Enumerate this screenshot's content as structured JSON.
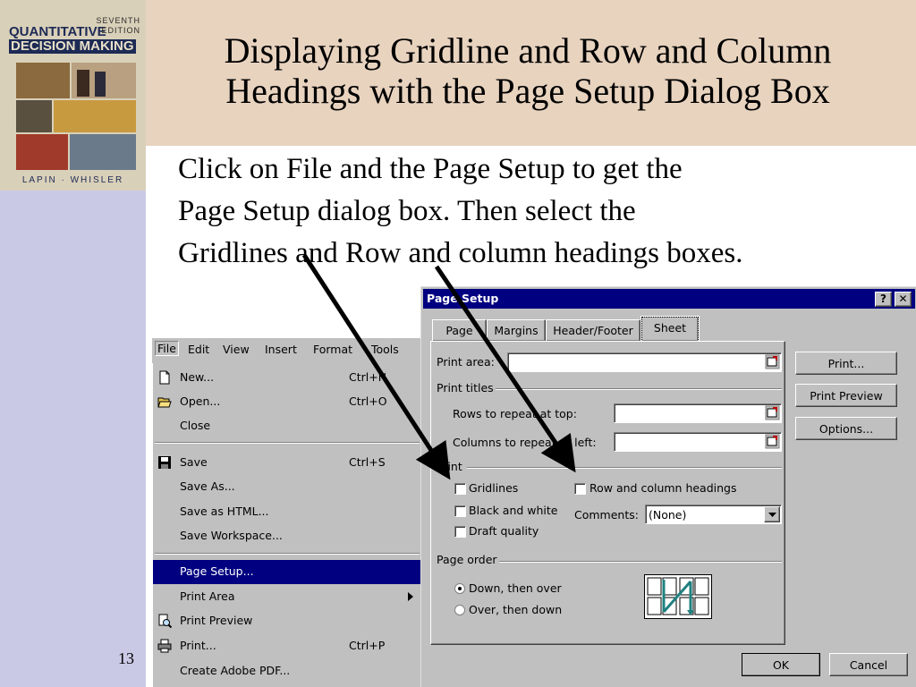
{
  "slide": {
    "title_line1": "Displaying Gridline and Row and Column",
    "title_line2": "Headings with the Page Setup Dialog Box",
    "body_line1": "Click on File and the Page Setup to get the",
    "body_line2": "Page Setup dialog box.  Then select the",
    "body_line3": "Gridlines and Row and column headings boxes.",
    "slide_number": "13"
  },
  "book": {
    "title_line1": "QUANTITATIVE",
    "title_line2": "DECISION MAKING",
    "edition_line1": "SEVENTH",
    "edition_line2": "EDITION",
    "authors": "LAPIN · WHISLER"
  },
  "menubar": {
    "file": "File",
    "edit": "Edit",
    "view": "View",
    "insert": "Insert",
    "format": "Format",
    "tools": "Tools"
  },
  "file_menu": {
    "new": {
      "label": "New...",
      "shortcut": "Ctrl+N"
    },
    "open": {
      "label": "Open...",
      "shortcut": "Ctrl+O"
    },
    "close": {
      "label": "Close"
    },
    "save": {
      "label": "Save",
      "shortcut": "Ctrl+S"
    },
    "save_as": {
      "label": "Save As..."
    },
    "save_html": {
      "label": "Save as HTML..."
    },
    "save_workspace": {
      "label": "Save Workspace..."
    },
    "page_setup": {
      "label": "Page Setup..."
    },
    "print_area": {
      "label": "Print Area"
    },
    "print_preview": {
      "label": "Print Preview"
    },
    "print": {
      "label": "Print...",
      "shortcut": "Ctrl+P"
    },
    "create_pdf": {
      "label": "Create Adobe PDF..."
    }
  },
  "dialog": {
    "title": "Page Setup",
    "help_glyph": "?",
    "close_glyph": "✕",
    "tabs": {
      "page": "Page",
      "margins": "Margins",
      "header_footer": "Header/Footer",
      "sheet": "Sheet"
    },
    "print_area_label": "Print area:",
    "print_area_value": "",
    "print_titles_label": "Print titles",
    "rows_repeat_label": "Rows to repeat at top:",
    "rows_repeat_value": "",
    "cols_repeat_label": "Columns to repeat at left:",
    "cols_repeat_value": "",
    "print_group_label": "Print",
    "gridlines_label": "Gridlines",
    "black_white_label": "Black and white",
    "draft_label": "Draft quality",
    "row_col_headings_label": "Row and column headings",
    "comments_label": "Comments:",
    "comments_value": "(None)",
    "page_order_label": "Page order",
    "down_over_label": "Down, then over",
    "over_down_label": "Over, then down",
    "buttons": {
      "print": "Print...",
      "print_preview": "Print Preview",
      "options": "Options...",
      "ok": "OK",
      "cancel": "Cancel"
    }
  },
  "colors": {
    "title_band": "#e8d3bf",
    "side_band": "#c9c9e6",
    "selection": "#000080"
  }
}
